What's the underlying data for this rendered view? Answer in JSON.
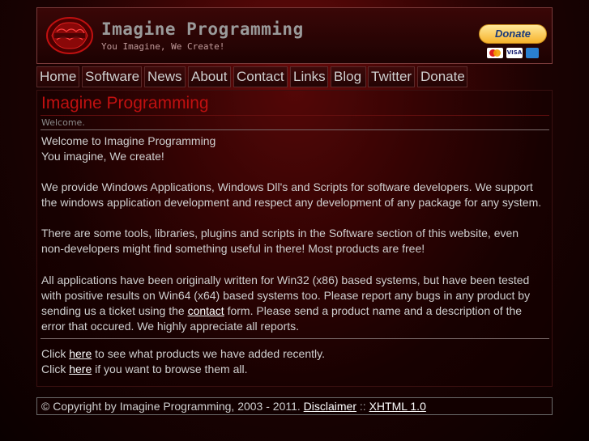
{
  "header": {
    "site_title": "Imagine Programming",
    "tagline": "You Imagine, We Create!",
    "donate_label": "Donate",
    "card_labels": [
      "VISA"
    ]
  },
  "nav": {
    "items": [
      {
        "label": "Home"
      },
      {
        "label": "Software"
      },
      {
        "label": "News"
      },
      {
        "label": "About"
      },
      {
        "label": "Contact"
      },
      {
        "label": "Links"
      },
      {
        "label": "Blog"
      },
      {
        "label": "Twitter"
      },
      {
        "label": "Donate"
      }
    ]
  },
  "main": {
    "title": "Imagine Programming",
    "subtitle": "Welcome.",
    "intro_line1": "Welcome to Imagine Programming",
    "intro_line2": "You imagine, We create!",
    "para1": "We provide Windows Applications, Windows Dll's and Scripts for software developers. We support the windows application development and respect any development of any package for any system.",
    "para2": "There are some tools, libraries, plugins and scripts in the Software section of this website, even non-developers might find something useful in there! Most products are free!",
    "para3_before": "All applications have been originally written for Win32 (x86) based systems, but have been tested with positive results on Win64 (x64) based systems too. Please report any bugs in any product by sending us a ticket using the ",
    "para3_link": "contact",
    "para3_after": " form. Please send a product name and a description of the error that occured. We highly appreciate all reports.",
    "line_recent_before": "Click ",
    "line_recent_link": "here",
    "line_recent_after": " to see what products we have added recently.",
    "line_browse_before": "Click ",
    "line_browse_link": "here",
    "line_browse_after": " if you want to browse them all."
  },
  "footer": {
    "copyright": "© Copyright by Imagine Programming, 2003 - 2011.",
    "disclaimer_label": "Disclaimer",
    "separator": "::",
    "xhtml_label": "XHTML 1.0"
  },
  "colors": {
    "accent_title": "#c01010",
    "link": "#ffffff",
    "donate_gold": "#f7b32c"
  }
}
